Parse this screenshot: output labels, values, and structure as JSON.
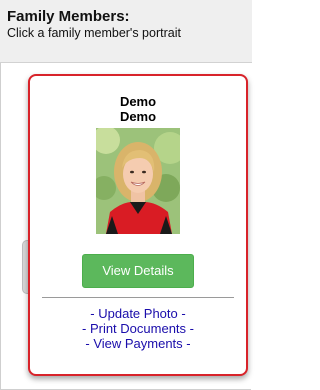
{
  "header": {
    "title": "Family Members:",
    "subtitle": "Click a family member's portrait"
  },
  "member": {
    "first_name": "Demo",
    "last_name": "Demo",
    "photo": "portrait-photo"
  },
  "actions": {
    "view_details": "View Details",
    "update_photo": "- Update Photo -",
    "print_documents": "- Print Documents -",
    "view_payments": "- View Payments -"
  },
  "colors": {
    "card_border": "#d8232a",
    "button": "#5cb85c",
    "link": "#1a0dab"
  }
}
